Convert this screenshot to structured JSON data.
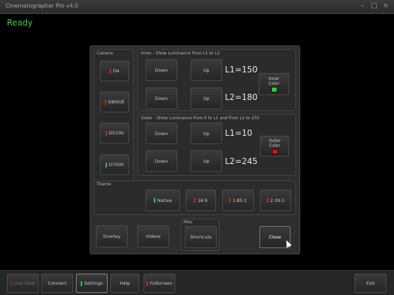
{
  "window": {
    "title": "Cinematographer Pro v4.0"
  },
  "status": "Ready",
  "camera": {
    "label": "Camera",
    "items": [
      {
        "label": "D4",
        "led": "red"
      },
      {
        "label": "D800/E",
        "led": "red"
      },
      {
        "label": "D5100",
        "led": "red"
      },
      {
        "label": "D7000",
        "led": "green"
      }
    ]
  },
  "inner": {
    "label": "Inner - Show Luminance from L1 to L2",
    "down": "Down",
    "up": "Up",
    "l1": "L1=150",
    "l2": "L2=180",
    "color_label": "Inner Color",
    "color": "#2bd12b"
  },
  "outer": {
    "label": "Outer - Show Luminance from 0 to L1 and from L2 to 255",
    "down": "Down",
    "up": "Up",
    "l1": "L1=10",
    "l2": "L2=245",
    "color_label": "Outer Color",
    "color": "#e01010"
  },
  "theme": {
    "label": "Theme",
    "items": [
      {
        "label": "Native",
        "led": "green"
      },
      {
        "label": "16:9",
        "led": "red"
      },
      {
        "label": "1.85:1",
        "led": "red"
      },
      {
        "label": "2.39:1",
        "led": "red"
      }
    ]
  },
  "misc": {
    "label": "Misc",
    "overlay": "Overlay",
    "videos": "Videos",
    "shortcuts": "Shortcuts",
    "close": "Close"
  },
  "bottom": {
    "live_view": "Live View",
    "connect": "Connect",
    "settings": "Settings",
    "help": "Help",
    "fullscreen": "Fullscreen",
    "exit": "Exit"
  },
  "colors": {
    "accent_green": "#2bd12b",
    "accent_red": "#d62020"
  }
}
